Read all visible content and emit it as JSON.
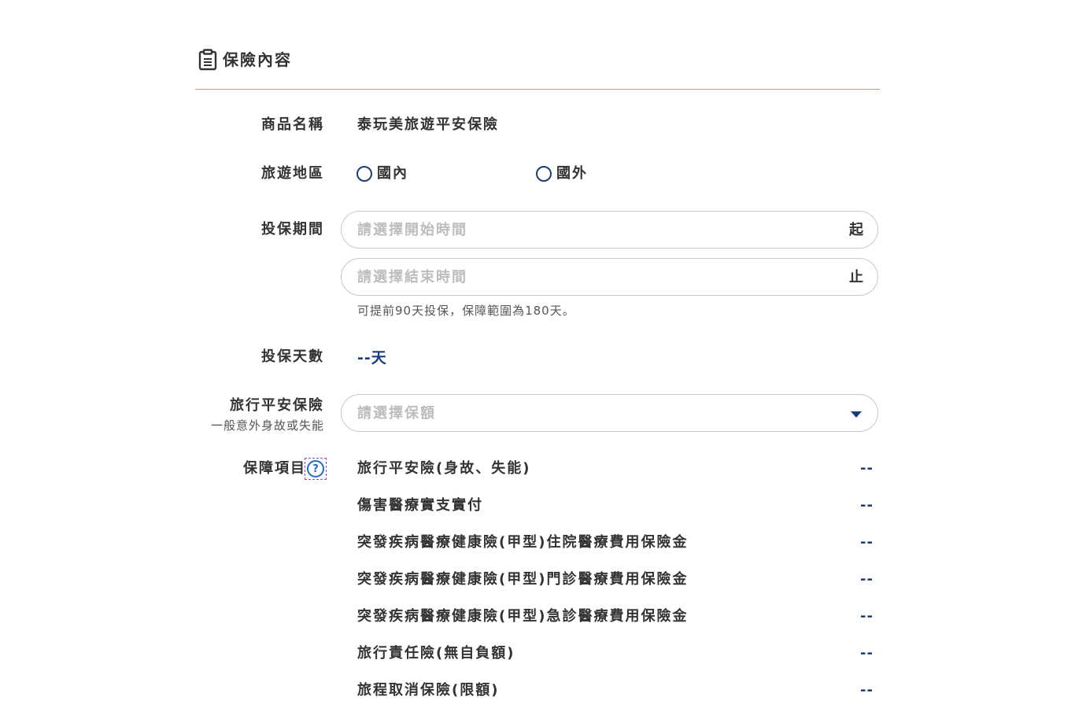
{
  "section": {
    "title": "保險內容",
    "icon": "clipboard-icon",
    "rule_color": "#c9a45c"
  },
  "product": {
    "label": "商品名稱",
    "value": "泰玩美旅遊平安保險"
  },
  "region": {
    "label": "旅遊地區",
    "options": [
      {
        "label": "國內",
        "selected": false
      },
      {
        "label": "國外",
        "selected": false
      }
    ]
  },
  "period": {
    "label": "投保期間",
    "start": {
      "placeholder": "請選擇開始時間",
      "suffix": "起",
      "value": ""
    },
    "end": {
      "placeholder": "請選擇結束時間",
      "suffix": "止",
      "value": ""
    },
    "hint": "可提前90天投保，保障範圍為180天。"
  },
  "days": {
    "label": "投保天數",
    "value": "--天"
  },
  "travel_insurance": {
    "label": "旅行平安保險",
    "sublabel": "一般意外身故或失能",
    "select_placeholder": "請選擇保額"
  },
  "coverage": {
    "label": "保障項目",
    "items": [
      {
        "name": "旅行平安險(身故、失能)",
        "value": "--"
      },
      {
        "name": "傷害醫療實支實付",
        "value": "--"
      },
      {
        "name": "突發疾病醫療健康險(甲型)住院醫療費用保險金",
        "value": "--"
      },
      {
        "name": "突發疾病醫療健康險(甲型)門診醫療費用保險金",
        "value": "--"
      },
      {
        "name": "突發疾病醫療健康險(甲型)急診醫療費用保險金",
        "value": "--"
      },
      {
        "name": "旅行責任險(無自負額)",
        "value": "--"
      },
      {
        "name": "旅程取消保險(限額)",
        "value": "--"
      }
    ]
  },
  "colors": {
    "accent": "#1a3d7c",
    "text": "#333333",
    "placeholder": "#bdbdbd",
    "help": "#1a6fd1"
  }
}
